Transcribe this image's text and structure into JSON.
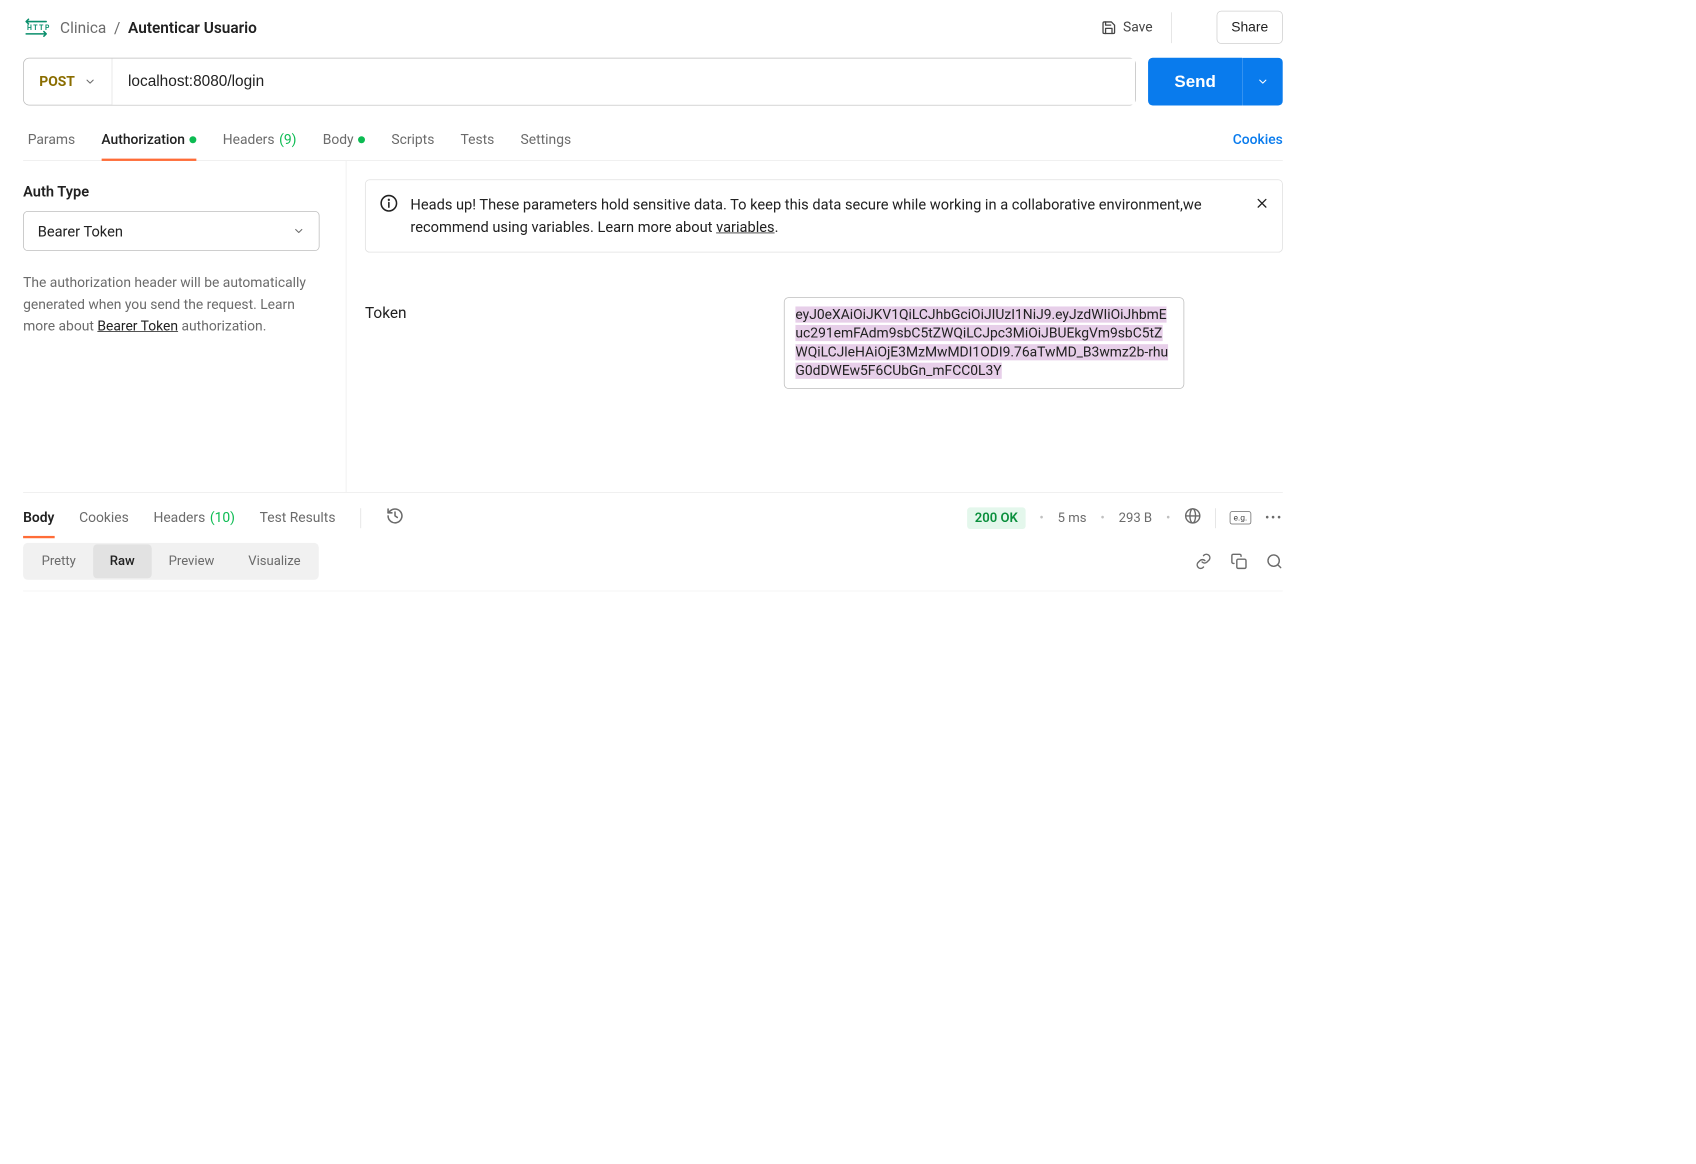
{
  "breadcrumb": {
    "parent": "Clinica",
    "sep": "/",
    "current": "Autenticar Usuario"
  },
  "topbar": {
    "save": "Save",
    "share": "Share"
  },
  "request": {
    "method": "POST",
    "url": "localhost:8080/login",
    "send": "Send"
  },
  "tabs": {
    "params": "Params",
    "authorization": "Authorization",
    "headers": "Headers",
    "headersCount": "(9)",
    "body": "Body",
    "scripts": "Scripts",
    "tests": "Tests",
    "settings": "Settings",
    "cookies": "Cookies"
  },
  "auth": {
    "typeLabel": "Auth Type",
    "typeValue": "Bearer Token",
    "descPrefix": "The authorization header will be automatically generated when you send the request. Learn more about ",
    "descLink": "Bearer Token",
    "descSuffix": " authorization.",
    "bannerPrefix": "Heads up! These parameters hold sensitive data. To keep this data secure while working in a collaborative environment,we recommend using variables. Learn more about ",
    "bannerLink": "variables",
    "bannerSuffix": ".",
    "tokenLabel": "Token",
    "tokenValue": "eyJ0eXAiOiJKV1QiLCJhbGciOiJIUzI1NiJ9.eyJzdWIiOiJhbmEuc291emFAdm9sbC5tZWQiLCJpc3MiOiJBUEkgVm9sbC5tZWQiLCJleHAiOjE3MzMwMDI1ODI9.76aTwMD_B3wmz2b-rhuG0dDWEw5F6CUbGn_mFCC0L3Y"
  },
  "response": {
    "tabs": {
      "body": "Body",
      "cookies": "Cookies",
      "headers": "Headers",
      "headersCount": "(10)",
      "testResults": "Test Results"
    },
    "status": "200 OK",
    "time": "5 ms",
    "size": "293 B",
    "eg": "e.g.",
    "views": {
      "pretty": "Pretty",
      "raw": "Raw",
      "preview": "Preview",
      "visualize": "Visualize"
    }
  }
}
